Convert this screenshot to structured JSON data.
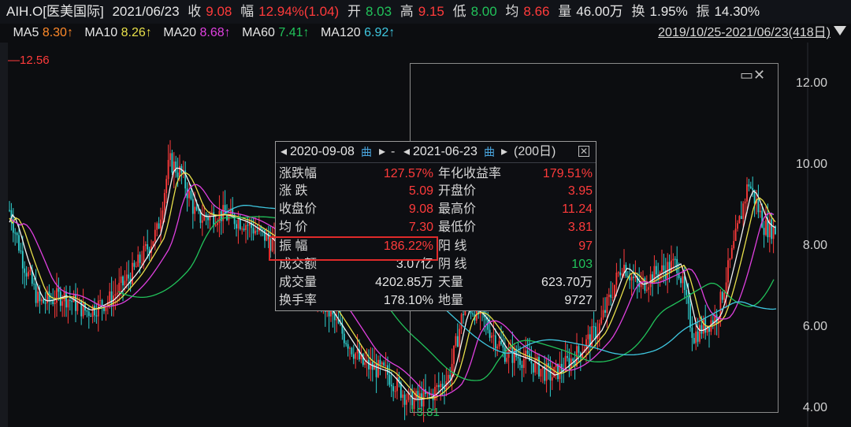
{
  "header": {
    "ticker": "AIH.O[医美国际]",
    "date": "2021/06/23",
    "close_label": "收",
    "close_value": "9.08",
    "change_label": "幅",
    "change_value": "12.94%(1.04)",
    "open_label": "开",
    "open_value": "8.03",
    "high_label": "高",
    "high_value": "9.15",
    "low_label": "低",
    "low_value": "8.00",
    "avg_label": "均",
    "avg_value": "8.66",
    "volume_label": "量",
    "volume_value": "46.00万",
    "turnover_label": "换",
    "turnover_value": "1.95%",
    "amplitude_label": "振",
    "amplitude_value": "14.30%"
  },
  "ma_bar": {
    "items": [
      {
        "label": "MA5",
        "value": "8.30↑",
        "color": "#e6e6e6"
      },
      {
        "label": "MA10",
        "value": "8.26↑",
        "color": "#e8e04a"
      },
      {
        "label": "MA20",
        "value": "8.68↑",
        "color": "#e040e0"
      },
      {
        "label": "MA60",
        "value": "7.41↑",
        "color": "#21c25a"
      },
      {
        "label": "MA120",
        "value": "6.92↑",
        "color": "#3fc7e0"
      }
    ],
    "range_text": "2019/10/25-2021/06/23(418日)"
  },
  "chart": {
    "y_ticks": [
      "12.00",
      "10.00",
      "8.00",
      "6.00",
      "4.00"
    ],
    "max_label": "12.56",
    "min_label": "3.81"
  },
  "popup": {
    "start_date": "2020-09-08",
    "end_date": "2021-06-23",
    "separator": "-",
    "days": "(200日)",
    "cal_icon_text": "曲",
    "left_rows": [
      {
        "label": "涨跌幅",
        "value": "127.57%",
        "color": "#ff3b3b"
      },
      {
        "label": "涨  跌",
        "value": "5.09",
        "color": "#ff3b3b"
      },
      {
        "label": "收盘价",
        "value": "9.08",
        "color": "#ff3b3b"
      },
      {
        "label": "均  价",
        "value": "7.30",
        "color": "#ff3b3b"
      },
      {
        "label": "振  幅",
        "value": "186.22%",
        "color": "#ff3b3b"
      },
      {
        "label": "成交额",
        "value": "3.07亿",
        "color": "#e6e6e6"
      },
      {
        "label": "成交量",
        "value": "4202.85万",
        "color": "#e6e6e6"
      },
      {
        "label": "换手率",
        "value": "178.10%",
        "color": "#e6e6e6"
      }
    ],
    "right_rows": [
      {
        "label": "年化收益率",
        "value": "179.51%",
        "color": "#ff3b3b"
      },
      {
        "label": "开盘价",
        "value": "3.95",
        "color": "#ff3b3b"
      },
      {
        "label": "最高价",
        "value": "11.24",
        "color": "#ff3b3b"
      },
      {
        "label": "最低价",
        "value": "3.81",
        "color": "#ff3b3b"
      },
      {
        "label": "阳  线",
        "value": "97",
        "color": "#ff3b3b"
      },
      {
        "label": "阴  线",
        "value": "103",
        "color": "#21c25a"
      },
      {
        "label": "天量",
        "value": "623.70万",
        "color": "#e6e6e6"
      },
      {
        "label": "地量",
        "value": "9727",
        "color": "#e6e6e6"
      }
    ]
  },
  "colors": {
    "up": "#ff3b3b",
    "down": "#21c25a",
    "highlight_border": "#e02a2a"
  }
}
